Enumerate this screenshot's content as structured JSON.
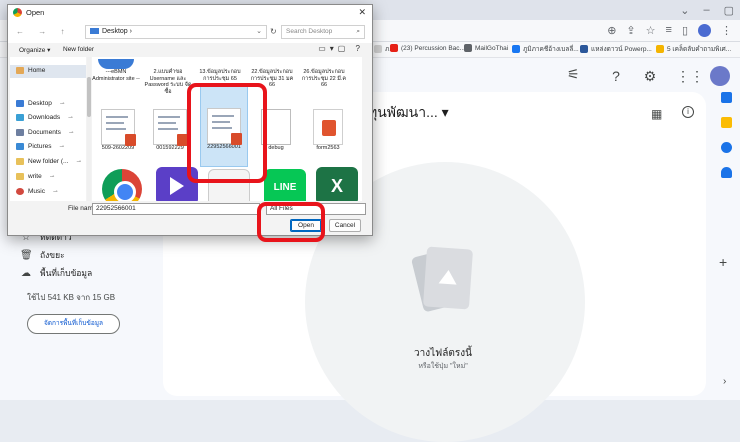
{
  "browser": {
    "bookmarks": [
      {
        "label": "ภ...",
        "color": "#d0d0d0"
      },
      {
        "label": "(23) Percussion Bac...",
        "color": "#e62117"
      },
      {
        "label": "MailGoThai",
        "color": "#5f6368"
      },
      {
        "label": "ภูมิภาคชีอ้างเบลลี่...",
        "color": "#1877f2"
      },
      {
        "label": "แหล่งดาวน์ Powerp...",
        "color": "#2b579a"
      },
      {
        "label": "5 เคล็ดลับคำถามพิเศ...",
        "color": "#f4b400"
      }
    ]
  },
  "drive": {
    "main_title": "ทุนพัฒนา...",
    "nav_items": [
      {
        "icon": "star-icon",
        "glyph": "☆",
        "label": "ที่ติดดาว"
      },
      {
        "icon": "trash-icon",
        "glyph": "🗑",
        "label": "ถังขยะ"
      },
      {
        "icon": "cloud-icon",
        "glyph": "☁",
        "label": "พื้นที่เก็บข้อมูล"
      }
    ],
    "storage_text": "ใช้ไป 541 KB จาก 15 GB",
    "storage_button": "จัดการพื้นที่เก็บข้อมูล",
    "drop_title": "วางไฟล์ตรงนี้",
    "drop_subtitle": "หรือใช้ปุ่ม \"ใหม่\""
  },
  "dialog": {
    "title": "Open",
    "close": "✕",
    "path": "Desktop ›",
    "search_placeholder": "Search Desktop",
    "organize": "Organize ▾",
    "new_folder": "New folder",
    "left_items": [
      {
        "label": "Home",
        "color": "#e3a857",
        "pin": ""
      },
      {
        "label": "Desktop",
        "color": "#3a7bd5",
        "pin": "📌"
      },
      {
        "label": "Downloads",
        "color": "#3aa0d5",
        "pin": "📌"
      },
      {
        "label": "Documents",
        "color": "#6e7fa0",
        "pin": "📌"
      },
      {
        "label": "Pictures",
        "color": "#3a8ad5",
        "pin": "📌"
      },
      {
        "label": "New folder (...",
        "color": "#e8c15a",
        "pin": "📌"
      },
      {
        "label": "write",
        "color": "#e8c15a",
        "pin": "📌"
      },
      {
        "label": "Music",
        "color": "#d2493f",
        "pin": "📌"
      }
    ],
    "files_row1": [
      "---eBMN Administrator site --",
      "2.แบบคำขอ Username และ Password ระบบ จัดซื้อ",
      "13.ข้อมูลประกอบ การประชุม 65",
      "22.ข้อมูลประกอบ การประชุม 31 มค 66",
      "26.ข้อมูลประกอบ การประชุม 22 มี.ค 66"
    ],
    "files_row2": [
      "509-2602209",
      "001592229",
      "22952566001",
      "debug",
      "form2563"
    ],
    "app_labels": [
      "LINE",
      "X"
    ],
    "file_name_label": "File name:",
    "file_name_value": "22952566001",
    "file_type": "All Files",
    "open_button": "Open",
    "cancel_button": "Cancel"
  }
}
